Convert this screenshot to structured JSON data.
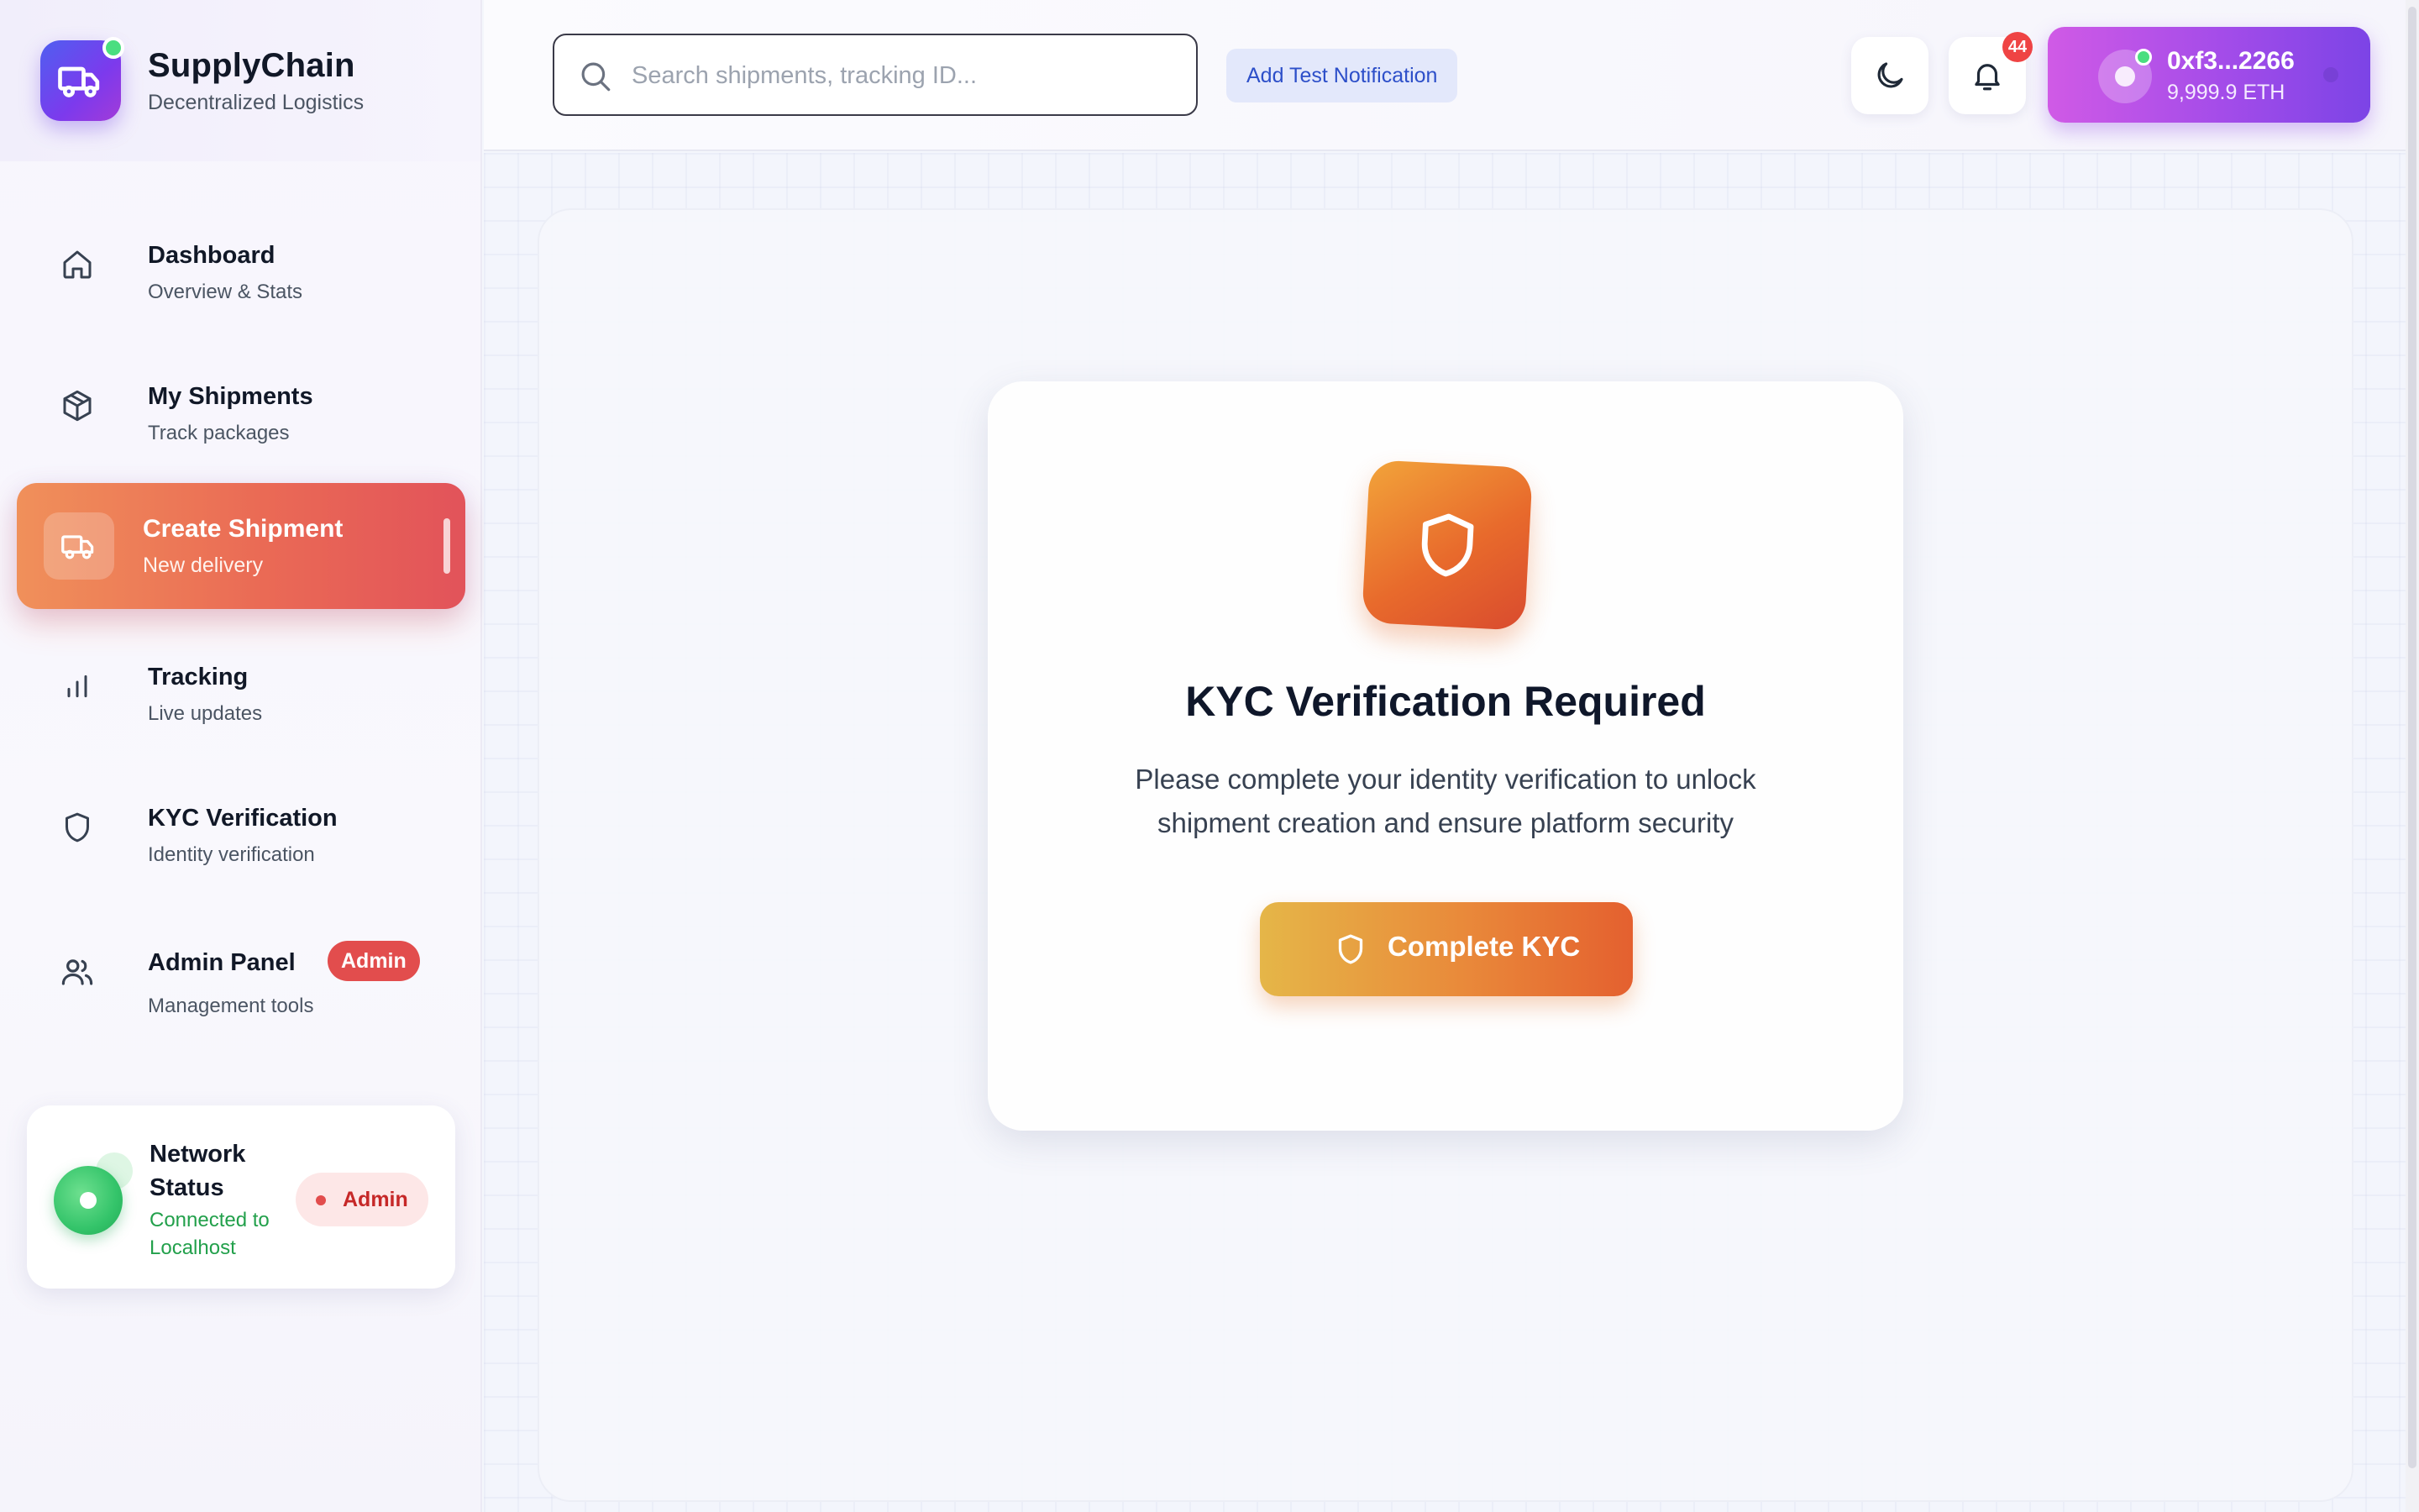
{
  "brand": {
    "title": "SupplyChain",
    "subtitle": "Decentralized Logistics"
  },
  "sidebar": {
    "items": [
      {
        "title": "Dashboard",
        "subtitle": "Overview & Stats",
        "icon": "home-icon"
      },
      {
        "title": "My Shipments",
        "subtitle": "Track packages",
        "icon": "package-icon"
      },
      {
        "title": "Create Shipment",
        "subtitle": "New delivery",
        "icon": "truck-icon",
        "active": true
      },
      {
        "title": "Tracking",
        "subtitle": "Live updates",
        "icon": "bar-chart-icon"
      },
      {
        "title": "KYC Verification",
        "subtitle": "Identity verification",
        "icon": "shield-icon"
      },
      {
        "title": "Admin Panel",
        "subtitle": "Management tools",
        "icon": "users-icon",
        "badge": "Admin"
      }
    ]
  },
  "network": {
    "title": "Network Status",
    "status": "Connected to Localhost",
    "role_badge": "Admin"
  },
  "header": {
    "search_placeholder": "Search shipments, tracking ID...",
    "test_button": "Add Test Notification",
    "notification_count": "44",
    "wallet_address": "0xf3...2266",
    "wallet_balance": "9,999.9 ETH"
  },
  "kyc": {
    "title": "KYC Verification Required",
    "description": "Please complete your identity verification to unlock shipment creation and ensure platform security",
    "button": "Complete KYC"
  },
  "colors": {
    "accent_purple": "#7c3aed",
    "active_orange": "#ea6a55",
    "status_green": "#22a04b",
    "admin_red": "#e24d4d"
  }
}
